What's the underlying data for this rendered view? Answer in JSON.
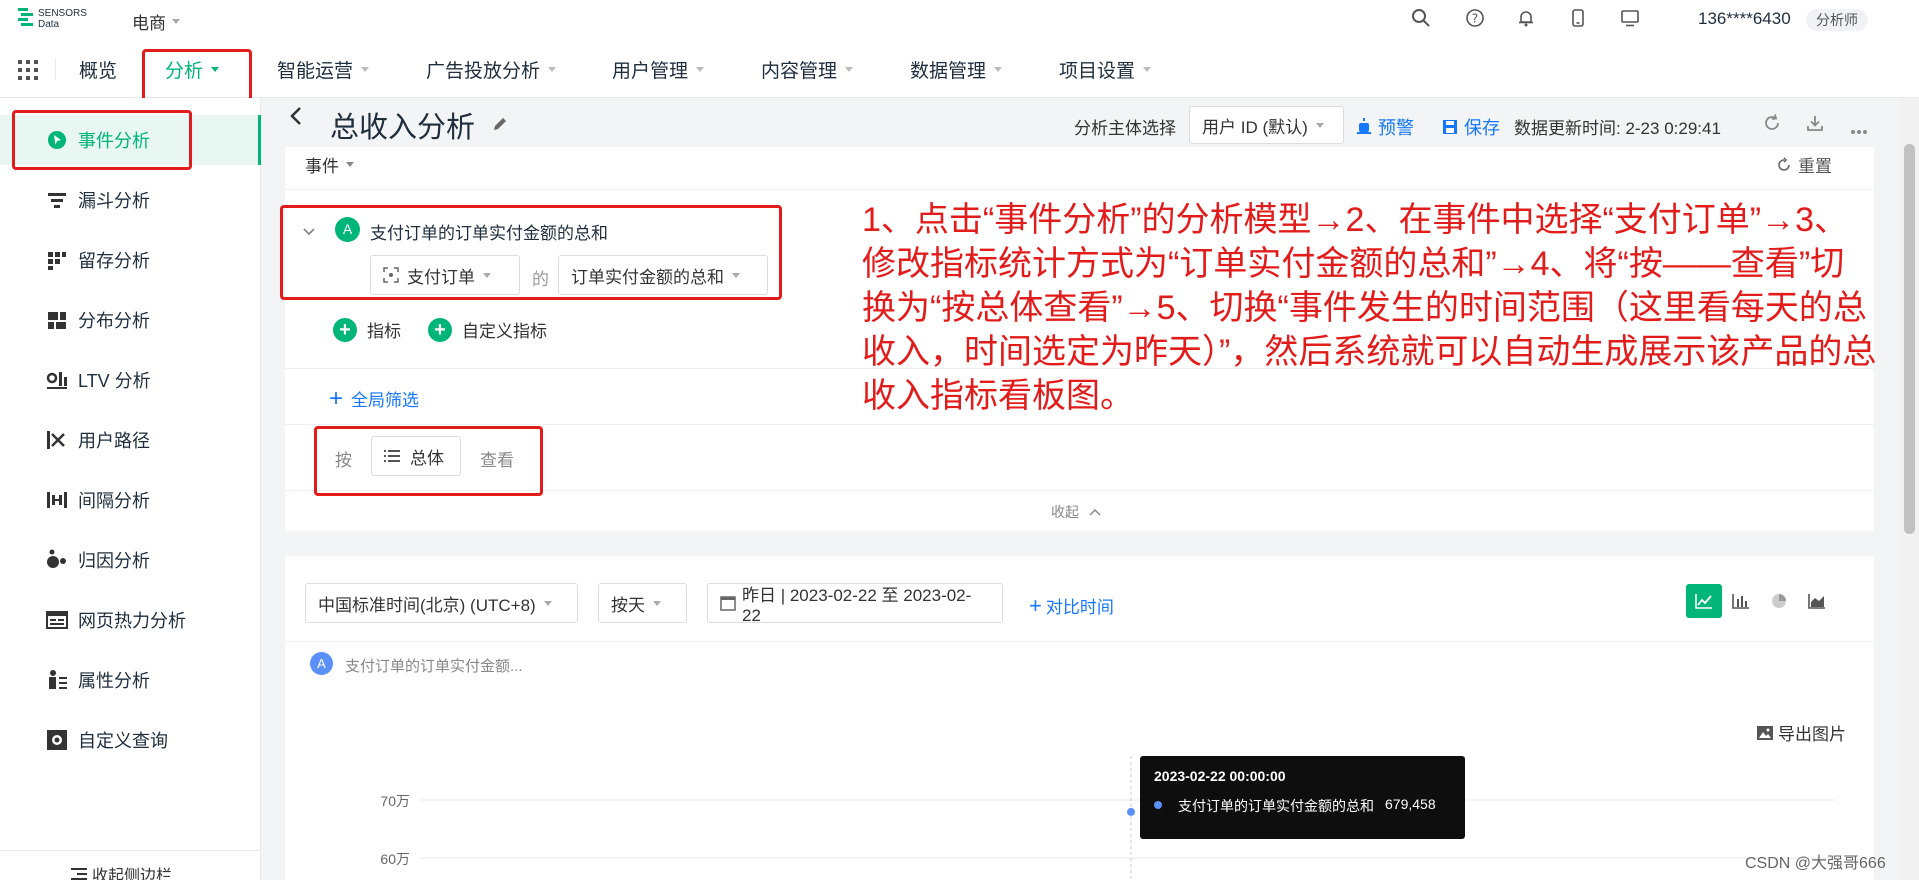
{
  "brand": {
    "name_line1": "SENSORS",
    "name_line2": "Data"
  },
  "project": "电商",
  "user": {
    "phone": "136****6430",
    "role": "分析师"
  },
  "nav": {
    "overview": "概览",
    "analysis": "分析",
    "smart_ops": "智能运营",
    "ad": "广告投放分析",
    "users": "用户管理",
    "content": "内容管理",
    "data": "数据管理",
    "settings": "项目设置"
  },
  "sidebar": {
    "items": [
      {
        "label": "事件分析"
      },
      {
        "label": "漏斗分析"
      },
      {
        "label": "留存分析"
      },
      {
        "label": "分布分析"
      },
      {
        "label": "LTV 分析"
      },
      {
        "label": "用户路径"
      },
      {
        "label": "间隔分析"
      },
      {
        "label": "归因分析"
      },
      {
        "label": "网页热力分析"
      },
      {
        "label": "属性分析"
      },
      {
        "label": "自定义查询"
      }
    ],
    "collapse": "收起侧边栏"
  },
  "page": {
    "title": "总收入分析",
    "subject_label": "分析主体选择",
    "subject_value": "用户 ID (默认)",
    "alert": "预警",
    "save": "保存",
    "updated": "数据更新时间: 2-23 0:29:41"
  },
  "query": {
    "event_label": "事件",
    "reset": "重置",
    "metric_badge": "A",
    "metric_title": "支付订单的订单实付金额的总和",
    "event_value": "支付订单",
    "of": "的",
    "agg_value": "订单实付金额的总和",
    "add_metric": "指标",
    "add_custom": "自定义指标",
    "global_filter": "全局筛选",
    "by": "按",
    "group_value": "总体",
    "view": "查看",
    "collapse": "收起"
  },
  "annotation": "1、点击“事件分析”的分析模型→2、在事件中选择“支付订单”→3、修改指标统计方式为“订单实付金额的总和”→4、将“按——查看”切换为“按总体查看”→5、切换“事件发生的时间范围（这里看每天的总收入，时间选定为昨天）”，然后系统就可以自动生成展示该产品的总收入指标看板图。",
  "annotation_lines": [
    "1、点击“事件分析”的分析模型→2、在事件中选择“支付订单”→3、",
    "修改指标统计方式为“订单实付金额的总和”→4、将“按——查看”切",
    "换为“按总体查看”→5、切换“事件发生的时间范围（这里看每天的总",
    "收入，时间选定为昨天）”，然后系统就可以自动生成展示该产品的总",
    "收入指标看板图。"
  ],
  "results": {
    "timezone": "中国标准时间(北京) (UTC+8)",
    "granularity": "按天",
    "date_range": "昨日 | 2023-02-22 至 2023-02-22",
    "compare": "对比时间",
    "legend_badge": "A",
    "legend_label": "支付订单的订单实付金额...",
    "export": "导出图片"
  },
  "chart_data": {
    "type": "line",
    "x": [
      "2023-02-22"
    ],
    "series": [
      {
        "name": "支付订单的订单实付金额的总和",
        "values": [
          679458
        ]
      }
    ],
    "ytick_labels": [
      "70万",
      "60万"
    ],
    "tooltip_time": "2023-02-22 00:00:00",
    "tooltip_value": "679,458"
  },
  "watermark": "CSDN @大强哥666",
  "colors": {
    "accent": "#00b578",
    "annotation": "#e21b1b",
    "link": "#1677ff"
  }
}
